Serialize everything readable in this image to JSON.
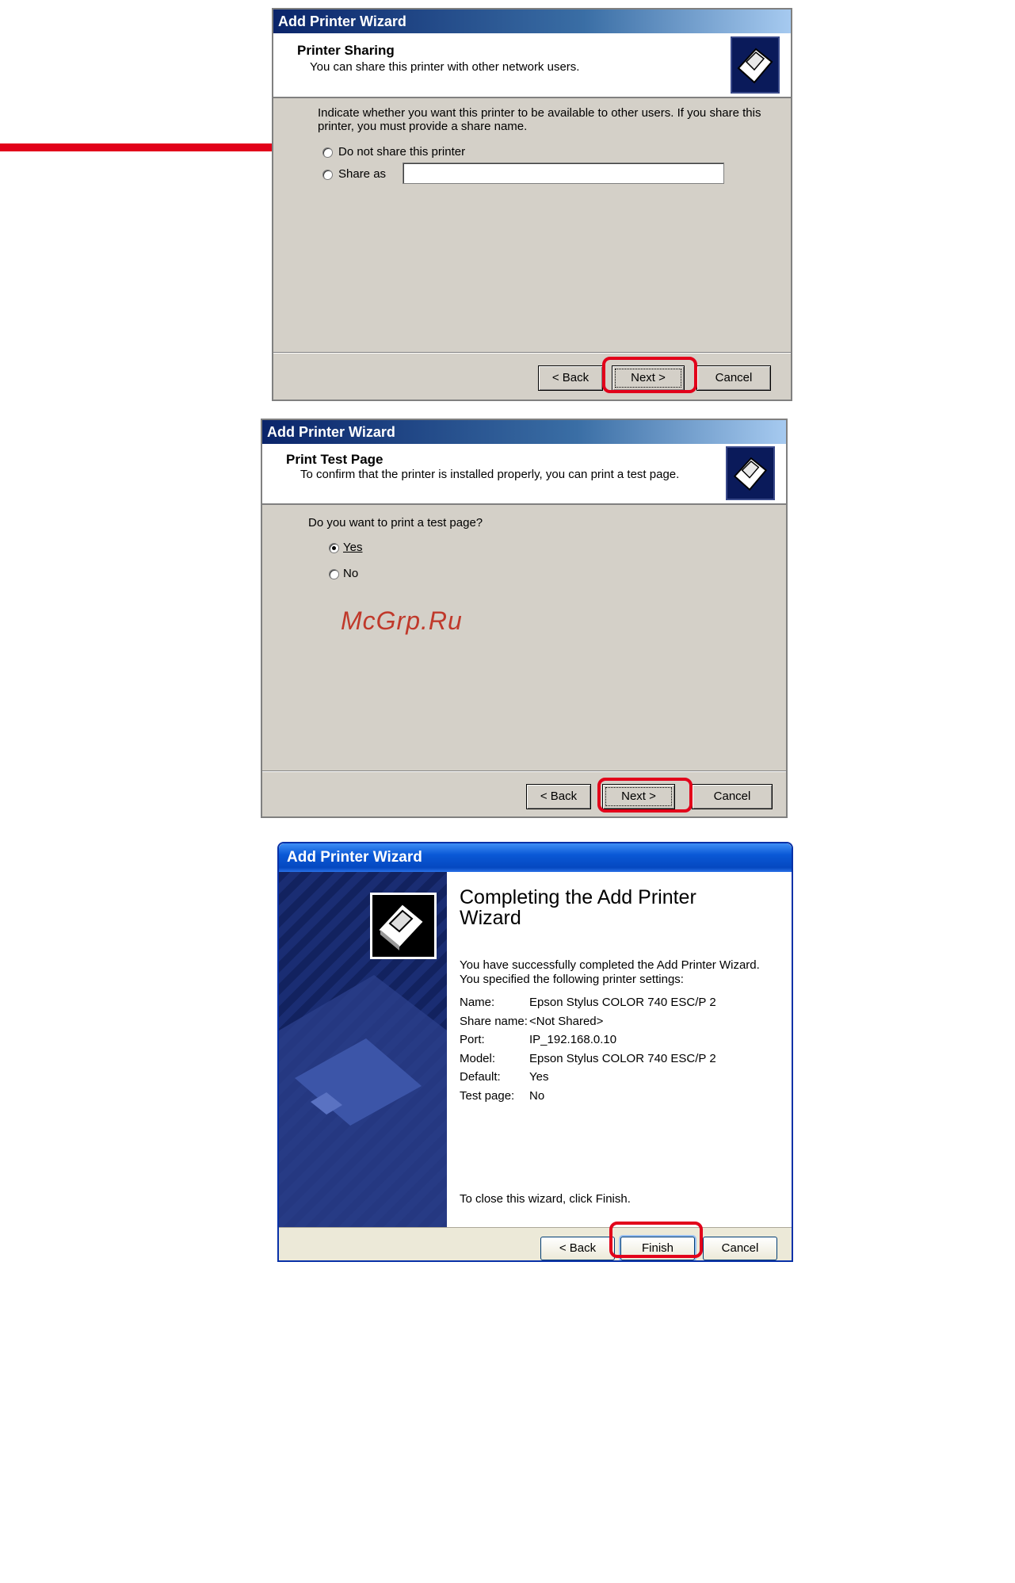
{
  "arrow_color": "#e2001a",
  "highlight_color": "#e2001a",
  "watermark": "McGrp.Ru",
  "dialog1": {
    "title": "Add Printer Wizard",
    "header_title": "Printer Sharing",
    "header_subtitle": "You can share this printer with other network users.",
    "instruction_line1": "Indicate whether you want this printer to be available to other users. If you share this",
    "instruction_line2": "printer, you must provide a share name.",
    "option_no_share": "Do not share this printer",
    "option_share_as": "Share as",
    "share_name_value": "",
    "buttons": {
      "back": "< Back",
      "next": "Next >",
      "cancel": "Cancel"
    }
  },
  "dialog2": {
    "title": "Add Printer Wizard",
    "header_title": "Print Test Page",
    "header_subtitle": "To confirm that the printer is installed properly, you can print a test page.",
    "question": "Do you want to print a test page?",
    "option_yes": "Yes",
    "option_no": "No",
    "buttons": {
      "back": "< Back",
      "next": "Next >",
      "cancel": "Cancel"
    }
  },
  "dialog3": {
    "title": "Add Printer Wizard",
    "heading_line1": "Completing the Add Printer",
    "heading_line2": "Wizard",
    "desc_line1": "You have successfully completed the Add Printer Wizard.",
    "desc_line2": "You specified the following printer settings:",
    "settings": [
      {
        "label": "Name:",
        "value": "Epson Stylus COLOR 740 ESC/P 2"
      },
      {
        "label": "Share name:",
        "value": "<Not Shared>"
      },
      {
        "label": "Port:",
        "value": "IP_192.168.0.10"
      },
      {
        "label": "Model:",
        "value": "Epson Stylus COLOR 740 ESC/P 2"
      },
      {
        "label": "Default:",
        "value": "Yes"
      },
      {
        "label": "Test page:",
        "value": "No"
      }
    ],
    "close_hint": "To close this wizard, click Finish.",
    "buttons": {
      "back": "< Back",
      "finish": "Finish",
      "cancel": "Cancel"
    }
  }
}
